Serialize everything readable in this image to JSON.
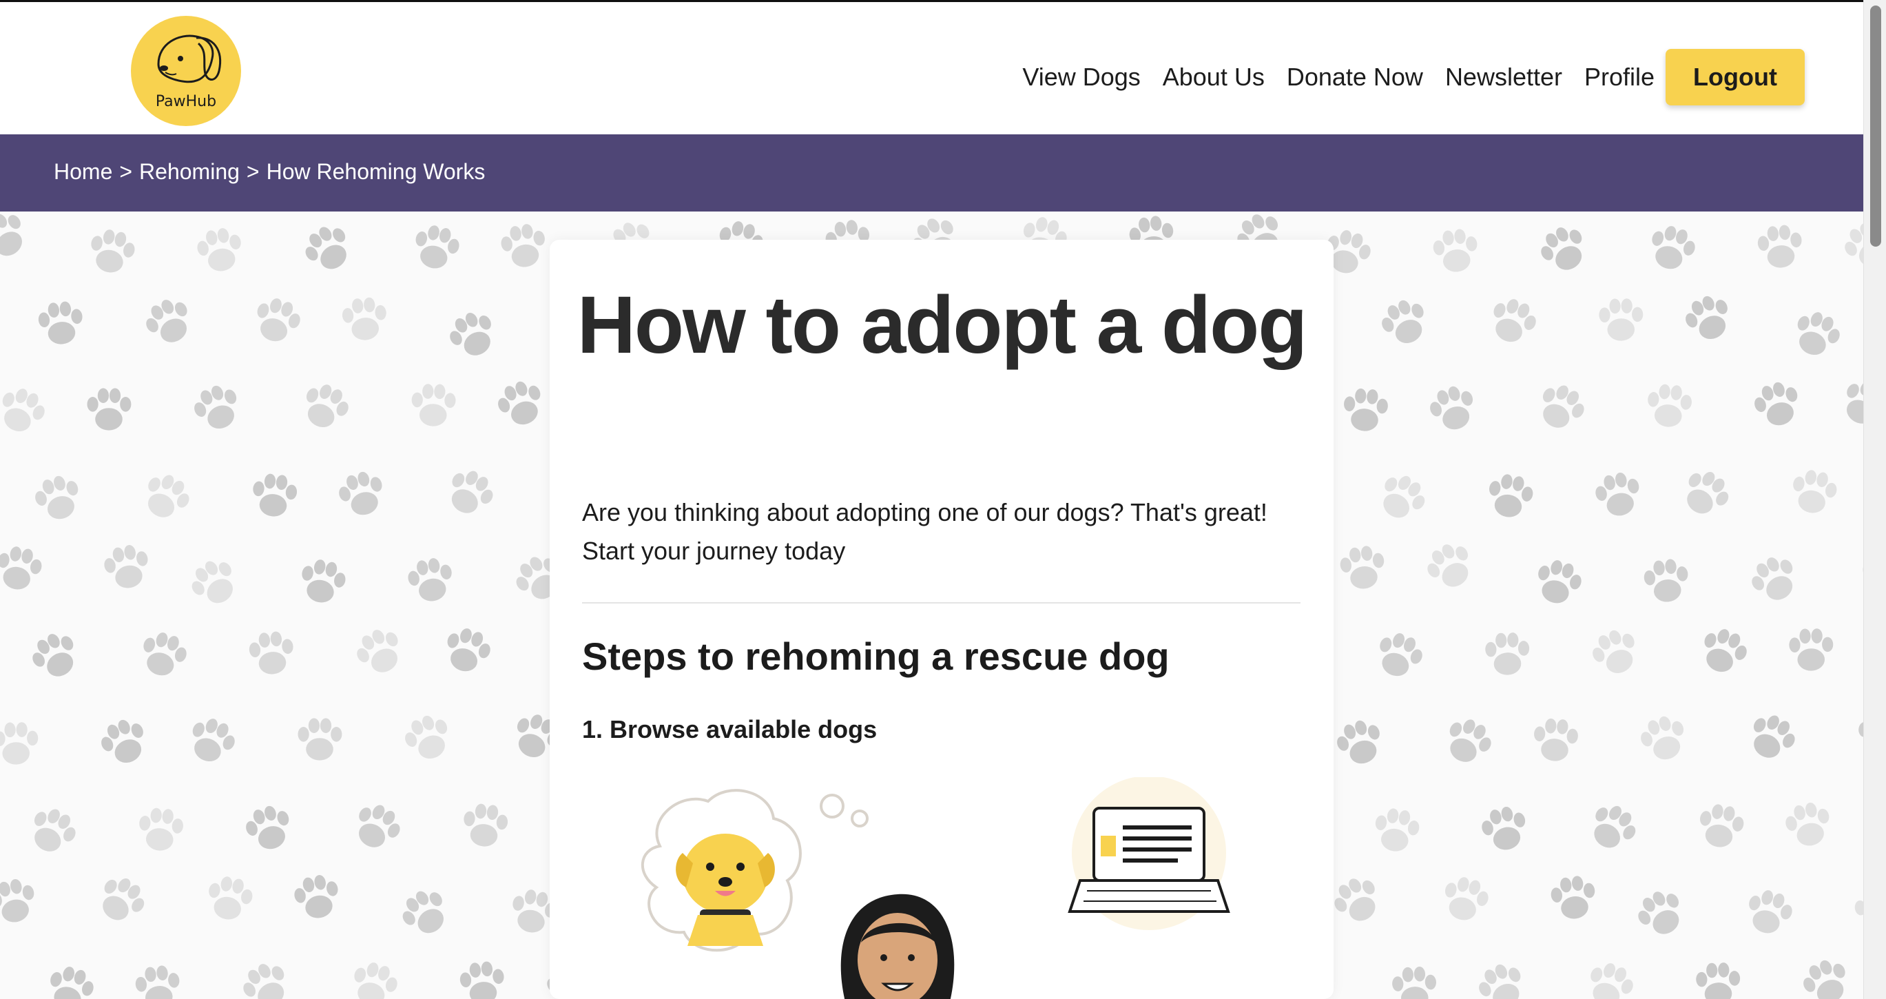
{
  "brand": {
    "name": "PawHub",
    "accent": "#f8d24f",
    "banner": "#4f4676"
  },
  "nav": {
    "links": [
      "View Dogs",
      "About Us",
      "Donate Now",
      "Newsletter",
      "Profile"
    ],
    "logout": "Logout"
  },
  "breadcrumb": {
    "home": "Home",
    "sep1": ">",
    "rehoming": "Rehoming",
    "sep2": ">",
    "current": "How Rehoming Works"
  },
  "content": {
    "title": "How to adopt a dog",
    "intro_line1": "Are you thinking about adopting one of our dogs? That's great!",
    "intro_line2": "Start your journey today",
    "steps_title": "Steps to rehoming a rescue dog",
    "step1": "1. Browse available dogs"
  }
}
